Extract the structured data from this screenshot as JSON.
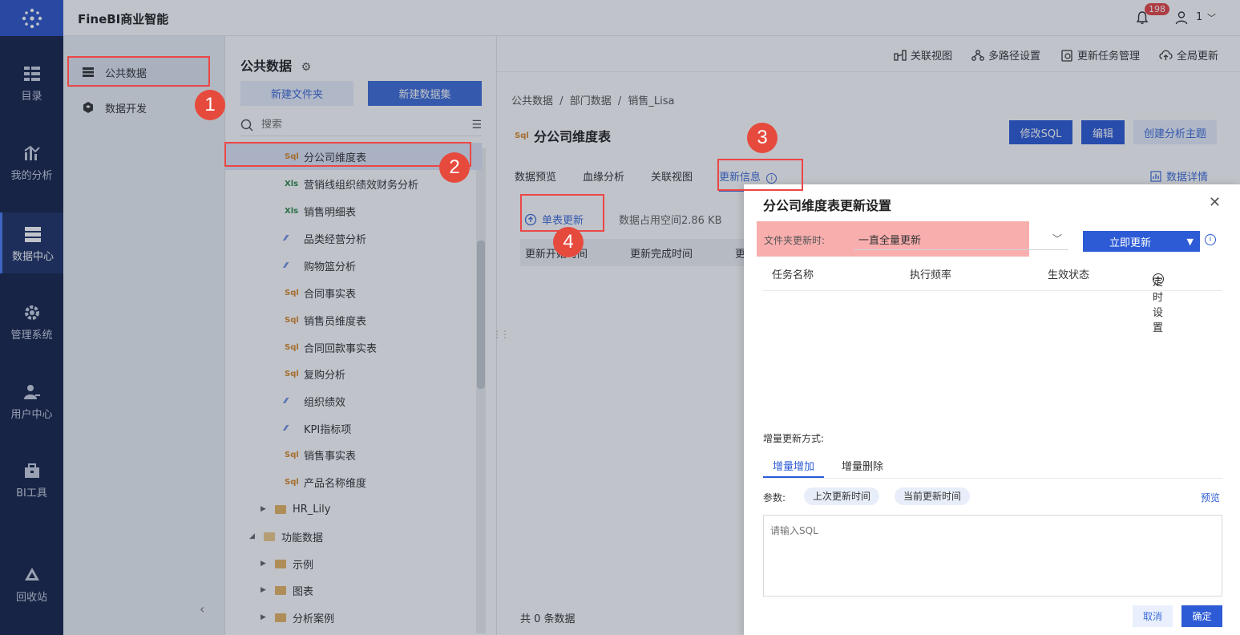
{
  "app": {
    "title": "FineBI商业智能",
    "notification_count": "198",
    "user": "1"
  },
  "leftnav": [
    {
      "label": "目录",
      "icon": "catalog-icon"
    },
    {
      "label": "我的分析",
      "icon": "analysis-icon"
    },
    {
      "label": "数据中心",
      "icon": "data-center-icon"
    },
    {
      "label": "管理系统",
      "icon": "gear-icon"
    },
    {
      "label": "用户中心",
      "icon": "user-icon"
    },
    {
      "label": "BI工具",
      "icon": "toolbox-icon"
    },
    {
      "label": "回收站",
      "icon": "recycle-icon"
    }
  ],
  "col2": {
    "items": [
      {
        "label": "公共数据"
      },
      {
        "label": "数据开发"
      }
    ]
  },
  "col3": {
    "title": "公共数据",
    "new_folder": "新建文件夹",
    "new_dataset": "新建数据集",
    "search_placeholder": "搜索",
    "tree": [
      {
        "label": "分公司维度表",
        "type": "sql",
        "icon_text": "Sql"
      },
      {
        "label": "营销线组织绩效财务分析",
        "type": "xls",
        "icon_text": "Xls"
      },
      {
        "label": "销售明细表",
        "type": "xls",
        "icon_text": "Xls"
      },
      {
        "label": "品类经营分析",
        "type": "an",
        "icon_text": "⁄⁄"
      },
      {
        "label": "购物篮分析",
        "type": "an",
        "icon_text": "⁄⁄"
      },
      {
        "label": "合同事实表",
        "type": "sql",
        "icon_text": "Sql"
      },
      {
        "label": "销售员维度表",
        "type": "sql",
        "icon_text": "Sql"
      },
      {
        "label": "合同回款事实表",
        "type": "sql",
        "icon_text": "Sql"
      },
      {
        "label": "复购分析",
        "type": "sql",
        "icon_text": "Sql"
      },
      {
        "label": "组织绩效",
        "type": "an",
        "icon_text": "⁄⁄"
      },
      {
        "label": "KPI指标项",
        "type": "an",
        "icon_text": "⁄⁄"
      },
      {
        "label": "销售事实表",
        "type": "sql",
        "icon_text": "Sql"
      },
      {
        "label": "产品名称维度",
        "type": "sql",
        "icon_text": "Sql"
      }
    ],
    "folders": [
      {
        "label": "HR_Lily",
        "expanded": false
      },
      {
        "label": "功能数据",
        "expanded": true
      },
      {
        "label": "示例",
        "expanded": false
      },
      {
        "label": "图表",
        "expanded": false
      },
      {
        "label": "分析案例",
        "expanded": false
      }
    ]
  },
  "toolbar": {
    "items": [
      "关联视图",
      "多路径设置",
      "更新任务管理",
      "全局更新"
    ]
  },
  "breadcrumb": [
    "公共数据",
    "/",
    "部门数据",
    "/",
    "销售_Lisa"
  ],
  "dataset": {
    "icon_text": "Sql",
    "title": "分公司维度表",
    "edit_sql": "修改SQL",
    "edit": "编辑",
    "create_topic": "创建分析主题"
  },
  "tabs": [
    "数据预览",
    "血缘分析",
    "关联视图",
    "更新信息"
  ],
  "data_detail": "数据详情",
  "update_panel": {
    "single_update": "单表更新",
    "space_used": "数据占用空间2.86 KB",
    "columns": [
      "更新开始时间",
      "更新完成时间",
      "更"
    ],
    "total": "共 0 条数据"
  },
  "dialog": {
    "title": "分公司维度表更新设置",
    "folder_update_label": "文件夹更新时:",
    "folder_update_value": "一直全量更新",
    "update_now": "立即更新",
    "task_columns": [
      "任务名称",
      "执行频率",
      "生效状态"
    ],
    "timer_setting": "定时设置",
    "incr_label": "增量更新方式:",
    "incr_tabs": [
      "增量增加",
      "增量删除"
    ],
    "params_label": "参数:",
    "params": [
      "上次更新时间",
      "当前更新时间"
    ],
    "preview": "预览",
    "sql_placeholder": "请输入SQL",
    "cancel": "取消",
    "ok": "确定"
  },
  "markers": [
    "1",
    "2",
    "3",
    "4"
  ],
  "colors": {
    "primary": "#2d5bd6",
    "nav_bg": "#15234a",
    "marker_red": "#e64a3d"
  }
}
